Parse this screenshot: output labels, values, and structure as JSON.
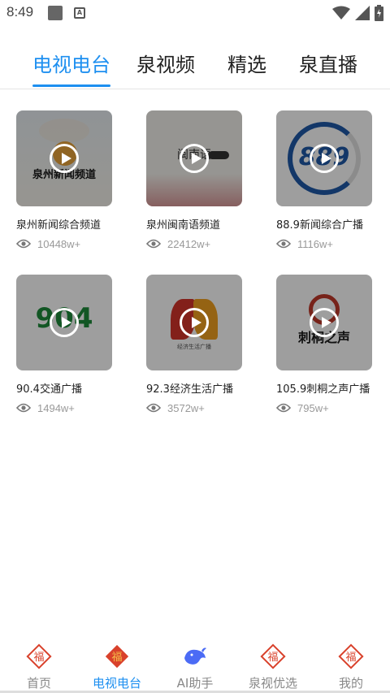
{
  "status_bar": {
    "time": "8:49",
    "notification_badge": "A"
  },
  "tabs": [
    {
      "label": "电视电台",
      "active": true
    },
    {
      "label": "泉视频",
      "active": false
    },
    {
      "label": "精选",
      "active": false
    },
    {
      "label": "泉直播",
      "active": false
    }
  ],
  "channels": [
    {
      "title": "泉州新闻综合频道",
      "views": "10448w+",
      "logo_text": "泉州新闻频道",
      "logo_color": "#1a1a1a"
    },
    {
      "title": "泉州闽南语频道",
      "views": "22412w+",
      "logo_text": "闽南语",
      "logo_color": "#333333"
    },
    {
      "title": "88.9新闻综合广播",
      "views": "1116w+",
      "logo_text": "889",
      "logo_color": "#1f5aa8"
    },
    {
      "title": "90.4交通广播",
      "views": "1494w+",
      "logo_text": "904",
      "logo_color": "#1e8c3a"
    },
    {
      "title": "92.3经济生活广播",
      "views": "3572w+",
      "logo_text": "经济生活广播",
      "logo_color": "#d4352b"
    },
    {
      "title": "105.9刺桐之声广播",
      "views": "795w+",
      "logo_text": "刺桐之声",
      "logo_color": "#8b1a1a"
    }
  ],
  "bottom_nav": [
    {
      "label": "首页",
      "icon": "fu-icon",
      "active": false
    },
    {
      "label": "电视电台",
      "icon": "fu-icon",
      "active": true
    },
    {
      "label": "AI助手",
      "icon": "whale-icon",
      "active": false
    },
    {
      "label": "泉视优选",
      "icon": "fu-icon",
      "active": false
    },
    {
      "label": "我的",
      "icon": "fu-icon",
      "active": false
    }
  ],
  "colors": {
    "accent": "#1d8ff0",
    "fu_red": "#d9412b",
    "text": "#222222",
    "muted": "#999999"
  }
}
